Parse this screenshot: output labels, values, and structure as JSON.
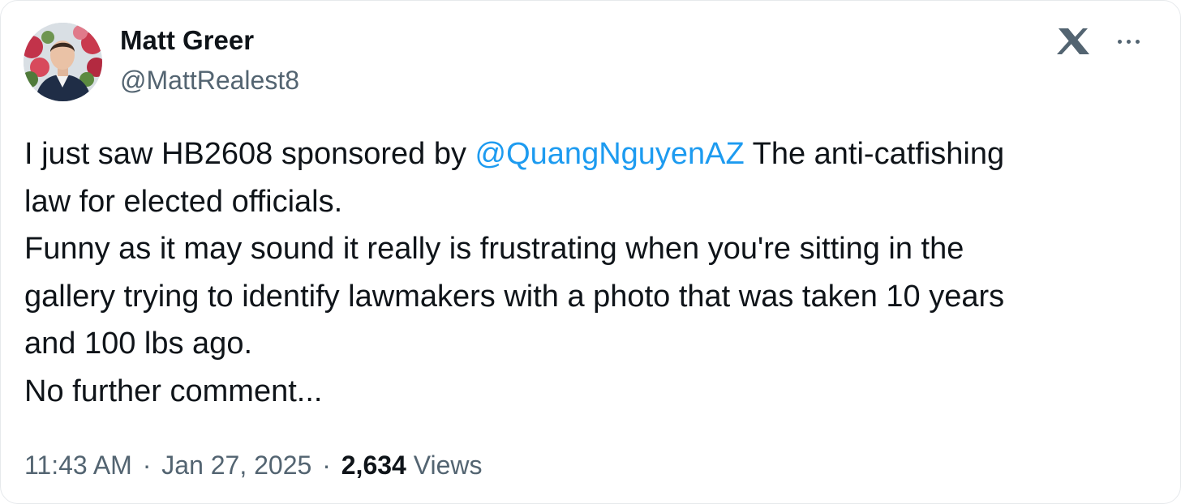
{
  "author": {
    "name": "Matt Greer",
    "handle": "@MattRealest8",
    "avatar_alt": "avatar"
  },
  "header_icons": {
    "logo": "x-logo-icon",
    "more": "more-horizontal-icon"
  },
  "tweet": {
    "line1_prefix": "I just saw HB2608 sponsored by ",
    "mention": "@QuangNguyenAZ",
    "line1_suffix": " The anti-catfishing",
    "line2": "law for elected officials.",
    "line3": "Funny as it may sound it really is frustrating when you're sitting in the",
    "line4": "gallery trying to identify lawmakers with a photo that was taken 10 years",
    "line5": "and 100 lbs ago.",
    "line6": "No further comment..."
  },
  "meta": {
    "time": "11:43 AM",
    "separator": "·",
    "date": "Jan 27, 2025",
    "views_count": "2,634",
    "views_label": "Views"
  },
  "colors": {
    "text": "#0f1419",
    "secondary": "#536471",
    "link": "#1d9bf0"
  }
}
